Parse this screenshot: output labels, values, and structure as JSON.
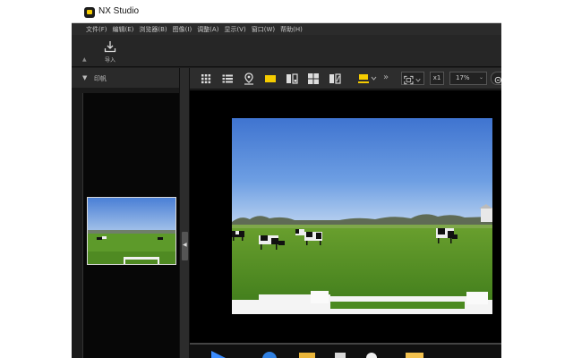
{
  "app": {
    "title": "NX Studio"
  },
  "menu": [
    {
      "label": "文件(F)"
    },
    {
      "label": "编辑(E)"
    },
    {
      "label": "浏览器(B)"
    },
    {
      "label": "图像(I)"
    },
    {
      "label": "调整(A)"
    },
    {
      "label": "显示(V)"
    },
    {
      "label": "窗口(W)"
    },
    {
      "label": "帮助(H)"
    }
  ],
  "import": {
    "label": "导入"
  },
  "left_panel": {
    "title": "印帆"
  },
  "view_toolbar": {
    "icons": [
      "grid-view-icon",
      "list-view-icon",
      "map-pin-icon",
      "single-image-icon",
      "compare-icon",
      "quad-view-icon",
      "before-after-icon",
      "filmstrip-toggle-icon",
      "more-icon",
      "fit-screen-icon"
    ],
    "x1_label": "x1",
    "zoom_value": "17%"
  },
  "colors": {
    "accent_yellow": "#f5cc00",
    "window_bg": "#1e1e1e",
    "panel_bg": "#1a1a1a"
  },
  "photo": {
    "subject": "cows-grazing-meadow-photo"
  }
}
